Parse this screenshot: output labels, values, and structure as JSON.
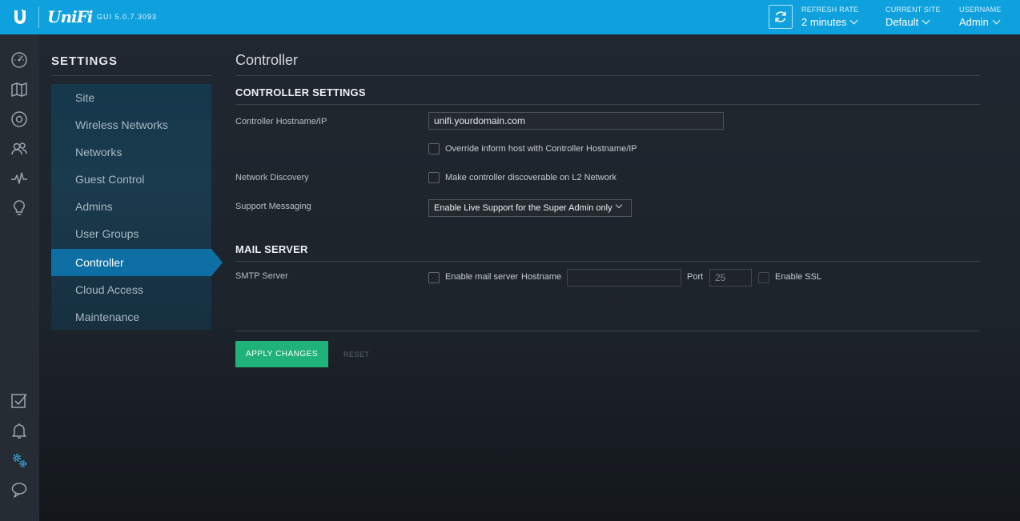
{
  "header": {
    "logo": "UniFi",
    "gui_version": "GUI 5.0.7.3093",
    "refresh_rate": {
      "label": "REFRESH RATE",
      "value": "2 minutes"
    },
    "current_site": {
      "label": "CURRENT SITE",
      "value": "Default"
    },
    "username": {
      "label": "USERNAME",
      "value": "Admin"
    }
  },
  "rail": {
    "icons": [
      "dashboard-icon",
      "map-icon",
      "devices-icon",
      "clients-icon",
      "statistics-icon",
      "insights-icon",
      "events-icon",
      "alerts-icon",
      "settings-icon",
      "chat-icon"
    ],
    "active": "settings-icon",
    "colors": {
      "default": "#9aa4ad",
      "active": "#2fa8e6"
    }
  },
  "settings": {
    "title": "SETTINGS",
    "nav": [
      "Site",
      "Wireless Networks",
      "Networks",
      "Guest Control",
      "Admins",
      "User Groups",
      "Controller",
      "Cloud Access",
      "Maintenance"
    ],
    "active_index": 6
  },
  "page": {
    "title": "Controller",
    "controller_settings": {
      "title": "CONTROLLER SETTINGS",
      "hostname_label": "Controller Hostname/IP",
      "hostname_value": "unifi.yourdomain.com",
      "override_label": "Override inform host with Controller Hostname/IP",
      "discovery_label": "Network Discovery",
      "discovery_checkbox_label": "Make controller discoverable on L2 Network",
      "support_label": "Support Messaging",
      "support_value": "Enable Live Support for the Super Admin only"
    },
    "mail_server": {
      "title": "MAIL SERVER",
      "smtp_label": "SMTP Server",
      "enable_label": "Enable mail server",
      "hostname_label": "Hostname",
      "hostname_value": "",
      "port_label": "Port",
      "port_placeholder": "25",
      "ssl_label": "Enable SSL"
    },
    "actions": {
      "apply": "APPLY CHANGES",
      "reset": "RESET"
    }
  },
  "colors": {
    "accent": "#0fa1dd",
    "active_nav": "#0e6fa4",
    "apply": "#1fb37a"
  }
}
